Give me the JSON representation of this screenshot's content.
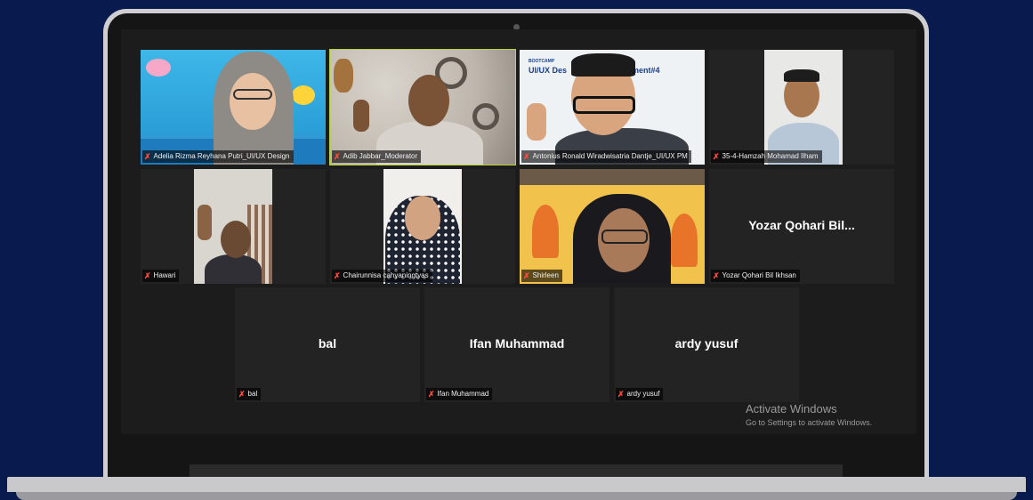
{
  "participants": [
    {
      "name": "Adelia Rizma Reyhana Putri_UI/UX Design",
      "mic": "muted-mic-icon",
      "video": true
    },
    {
      "name": "Adib Jabbar_Moderator",
      "mic": "muted-mic-icon",
      "video": true,
      "active_speaker": true
    },
    {
      "name": "Antonius Ronald Wiradwisatria Dantje_UI/UX PM",
      "mic": "muted-mic-icon",
      "video": true
    },
    {
      "name": "35-4-Hamzah Mohamad Ilham",
      "mic": "muted-mic-icon",
      "video": true
    },
    {
      "name": "Hawari",
      "mic": "muted-mic-icon",
      "video": true
    },
    {
      "name": "Chairunnisa cahyaningtyas",
      "mic": "muted-mic-icon",
      "video": true
    },
    {
      "name": "Shirleen",
      "mic": "muted-mic-icon",
      "video": true
    },
    {
      "name": "Yozar Qohari Bil Ikhsan",
      "display": "Yozar Qohari Bil...",
      "mic": "muted-mic-icon",
      "video": false
    },
    {
      "name": "bal",
      "display": "bal",
      "mic": "muted-mic-icon",
      "video": false
    },
    {
      "name": "Ifan Muhammad",
      "display": "Ifan Muhammad",
      "mic": "muted-mic-icon",
      "video": false
    },
    {
      "name": "ardy yusuf",
      "display": "ardy yusuf",
      "mic": "muted-mic-icon",
      "video": false
    }
  ],
  "slide_text": {
    "tag": "BOOTCAMP",
    "line": "UI/UX Des",
    "suffix": "ment#4"
  },
  "watermark": {
    "title": "Activate Windows",
    "subtitle": "Go to Settings to activate Windows."
  },
  "colors": {
    "background": "#081a4e",
    "active_speaker_border": "#b9d43a",
    "muted_mic": "#ff4a3c"
  }
}
